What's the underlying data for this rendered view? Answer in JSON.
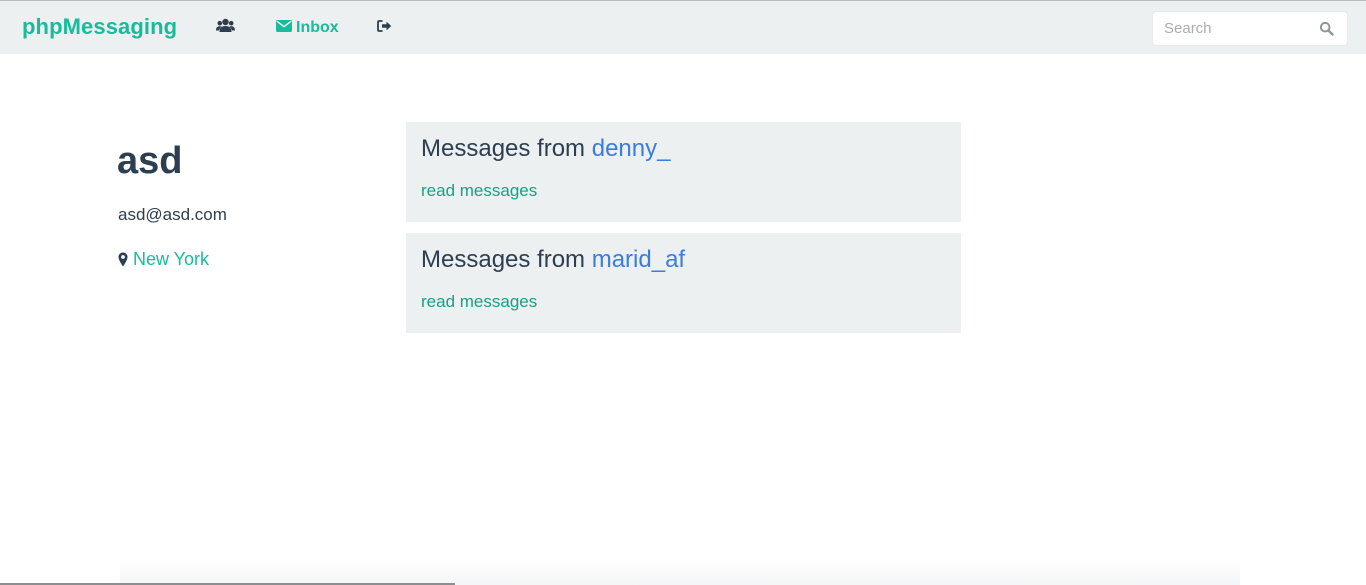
{
  "navbar": {
    "brand": "phpMessaging",
    "inbox_label": "Inbox",
    "users_icon": "users-icon",
    "inbox_icon": "envelope-icon",
    "logout_icon": "sign-out-icon",
    "search": {
      "placeholder": "Search",
      "value": "",
      "icon": "search-icon"
    }
  },
  "profile": {
    "name": "asd",
    "email": "asd@asd.com",
    "location_icon": "map-marker-icon",
    "location": "New York"
  },
  "message_threads": [
    {
      "prefix": "Messages from ",
      "username": "denny_",
      "link_label": "read messages"
    },
    {
      "prefix": "Messages from ",
      "username": "marid_af",
      "link_label": "read messages"
    }
  ],
  "colors": {
    "brand": "#18bc9c",
    "text_dark": "#2c3e50",
    "username_link": "#3b7ddd",
    "card_background": "#ecf0f1"
  }
}
